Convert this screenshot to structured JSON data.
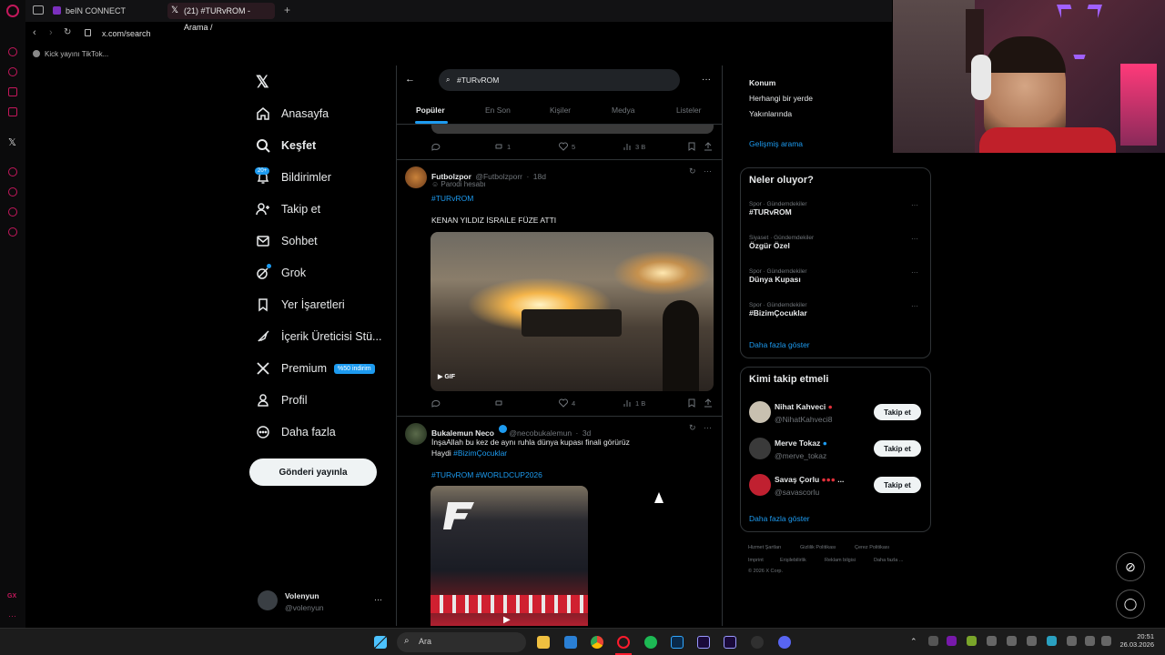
{
  "tabs": [
    {
      "label": "beIN CONNECT"
    },
    {
      "label": "(21) #TURvROM - Arama /"
    }
  ],
  "url": "x.com/search",
  "bookmark": "Kick yayını TikTok...",
  "nav": {
    "items": [
      {
        "label": "Anasayfa",
        "icon": "home-icon"
      },
      {
        "label": "Keşfet",
        "icon": "search-icon"
      },
      {
        "label": "Bildirimler",
        "icon": "bell-icon"
      },
      {
        "label": "Takip et",
        "icon": "add-user-icon"
      },
      {
        "label": "Sohbet",
        "icon": "mail-icon"
      },
      {
        "label": "Grok",
        "icon": "grok-icon"
      },
      {
        "label": "Yer İşaretleri",
        "icon": "bookmark-icon"
      },
      {
        "label": "İçerik Üreticisi Stü...",
        "icon": "rocket-icon"
      },
      {
        "label": "Premium",
        "icon": "x-logo-icon"
      },
      {
        "label": "Profil",
        "icon": "person-icon"
      },
      {
        "label": "Daha fazla",
        "icon": "more-circle-icon"
      }
    ],
    "notif_badge": "20+",
    "premium_badge": "%50 indirim",
    "post_button": "Gönderi yayınla",
    "user": {
      "name": "Volenyun",
      "handle": "@volenyun"
    }
  },
  "search": {
    "query": "#TURvROM"
  },
  "search_tabs": [
    "Popüler",
    "En Son",
    "Kişiler",
    "Medya",
    "Listeler"
  ],
  "tweets": [
    {
      "stats": {
        "replies": "",
        "retweets": "1",
        "likes": "5",
        "views": "3 B"
      }
    },
    {
      "name": "Futbolzpor",
      "handle": "@Futbolzporr",
      "time": "18d",
      "parody": "Parodi hesabı",
      "hashtag": "#TURvROM",
      "text": "KENAN YILDIZ İSRAİLE FÜZE ATTI",
      "media_label": "GIF",
      "stats": {
        "replies": "",
        "retweets": "",
        "likes": "4",
        "views": "1 B"
      }
    },
    {
      "name": "Bukalemun Neco",
      "handle": "@necobukalemun",
      "time": "3d",
      "text1": "İnşaAllah bu kez de aynı ruhla dünya kupası finali görürüz",
      "text2_prefix": "Haydi ",
      "text2_tag": "#BizimÇocuklar",
      "tags": "#TURvROM",
      "tags2": "#WORLDCUP2026"
    }
  ],
  "right": {
    "location": {
      "title": "Konum",
      "opt1": "Herhangi bir yerde",
      "opt2": "Yakınlarında",
      "advanced": "Gelişmiş arama"
    },
    "trends_title": "Neler oluyor?",
    "trends": [
      {
        "cat": "Spor · Gündemdekiler",
        "name": "#TURvROM"
      },
      {
        "cat": "Siyaset · Gündemdekiler",
        "name": "Özgür Özel"
      },
      {
        "cat": "Spor · Gündemdekiler",
        "name": "Dünya Kupası"
      },
      {
        "cat": "Spor · Gündemdekiler",
        "name": "#BizimÇocuklar"
      }
    ],
    "trends_more": "Daha fazla göster",
    "follow_title": "Kimi takip etmeli",
    "follow": [
      {
        "name": "Nihat Kahveci",
        "handle": "@NihatKahveci8",
        "button": "Takip et"
      },
      {
        "name": "Merve Tokaz",
        "handle": "@merve_tokaz",
        "button": "Takip et"
      },
      {
        "name": "Savaş Çorlu",
        "handle": "@savascorlu",
        "button": "Takip et"
      }
    ],
    "follow_more": "Daha fazla göster",
    "footer": [
      "Hizmet Şartları",
      "Gizlilik Politikası",
      "Çerez Politikası",
      "Imprint",
      "Erişilebilirlik",
      "Reklam bilgisi",
      "Daha fazla ...",
      "© 2026 X Corp."
    ]
  },
  "taskbar": {
    "search": "Ara",
    "time": "20:51",
    "date": "26.03.2026"
  }
}
